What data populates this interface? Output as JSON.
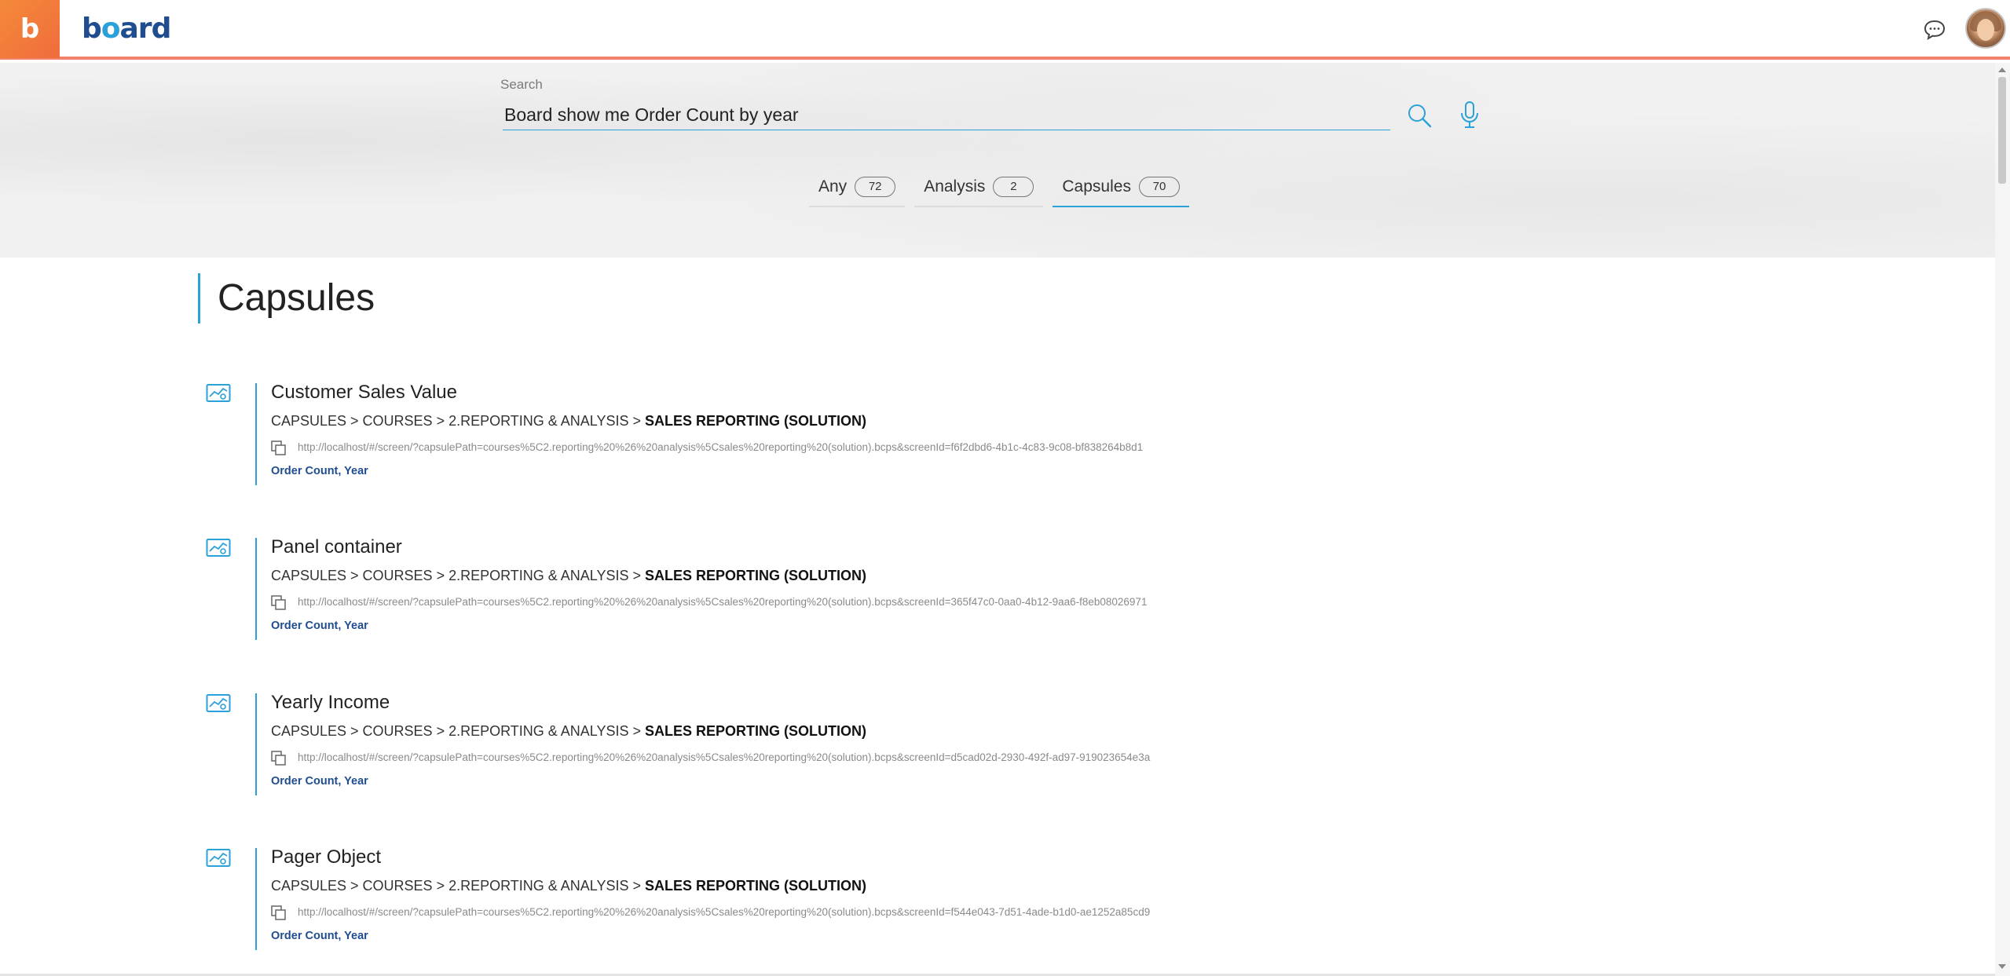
{
  "app": {
    "logo_letter": "b",
    "logo_name_pre": "b",
    "logo_name_o": "o",
    "logo_name_post": "ard"
  },
  "header": {
    "chat_icon": "chat-bubble-icon",
    "avatar_icon": "user-avatar"
  },
  "search": {
    "label": "Search",
    "value": "Board show me Order Count by year",
    "search_icon": "search-icon",
    "mic_icon": "microphone-icon"
  },
  "tabs": [
    {
      "label": "Any",
      "count": "72"
    },
    {
      "label": "Analysis",
      "count": "2"
    },
    {
      "label": "Capsules",
      "count": "70"
    }
  ],
  "section": {
    "title": "Capsules"
  },
  "colors": {
    "accent": "#2aa1d9",
    "brand": "#1f4d8f",
    "top_border": "#f0836a",
    "logo_orange": "#f58a3a"
  },
  "results": [
    {
      "title": "Customer Sales Value",
      "path": "CAPSULES > COURSES > 2.REPORTING & ANALYSIS > ",
      "path_strong": "SALES REPORTING (SOLUTION)",
      "url": "http://localhost/#/screen/?capsulePath=courses%5C2.reporting%20%26%20analysis%5Csales%20reporting%20(solution).bcps&screenId=f6f2dbd6-4b1c-4c83-9c08-bf838264b8d1",
      "tags": "Order Count, Year"
    },
    {
      "title": "Panel container",
      "path": "CAPSULES > COURSES > 2.REPORTING & ANALYSIS > ",
      "path_strong": "SALES REPORTING (SOLUTION)",
      "url": "http://localhost/#/screen/?capsulePath=courses%5C2.reporting%20%26%20analysis%5Csales%20reporting%20(solution).bcps&screenId=365f47c0-0aa0-4b12-9aa6-f8eb08026971",
      "tags": "Order Count, Year"
    },
    {
      "title": "Yearly Income",
      "path": "CAPSULES > COURSES > 2.REPORTING & ANALYSIS > ",
      "path_strong": "SALES REPORTING (SOLUTION)",
      "url": "http://localhost/#/screen/?capsulePath=courses%5C2.reporting%20%26%20analysis%5Csales%20reporting%20(solution).bcps&screenId=d5cad02d-2930-492f-ad97-919023654e3a",
      "tags": "Order Count, Year"
    },
    {
      "title": "Pager Object",
      "path": "CAPSULES > COURSES > 2.REPORTING & ANALYSIS > ",
      "path_strong": "SALES REPORTING (SOLUTION)",
      "url": "http://localhost/#/screen/?capsulePath=courses%5C2.reporting%20%26%20analysis%5Csales%20reporting%20(solution).bcps&screenId=f544e043-7d51-4ade-b1d0-ae1252a85cd9",
      "tags": "Order Count, Year"
    }
  ]
}
